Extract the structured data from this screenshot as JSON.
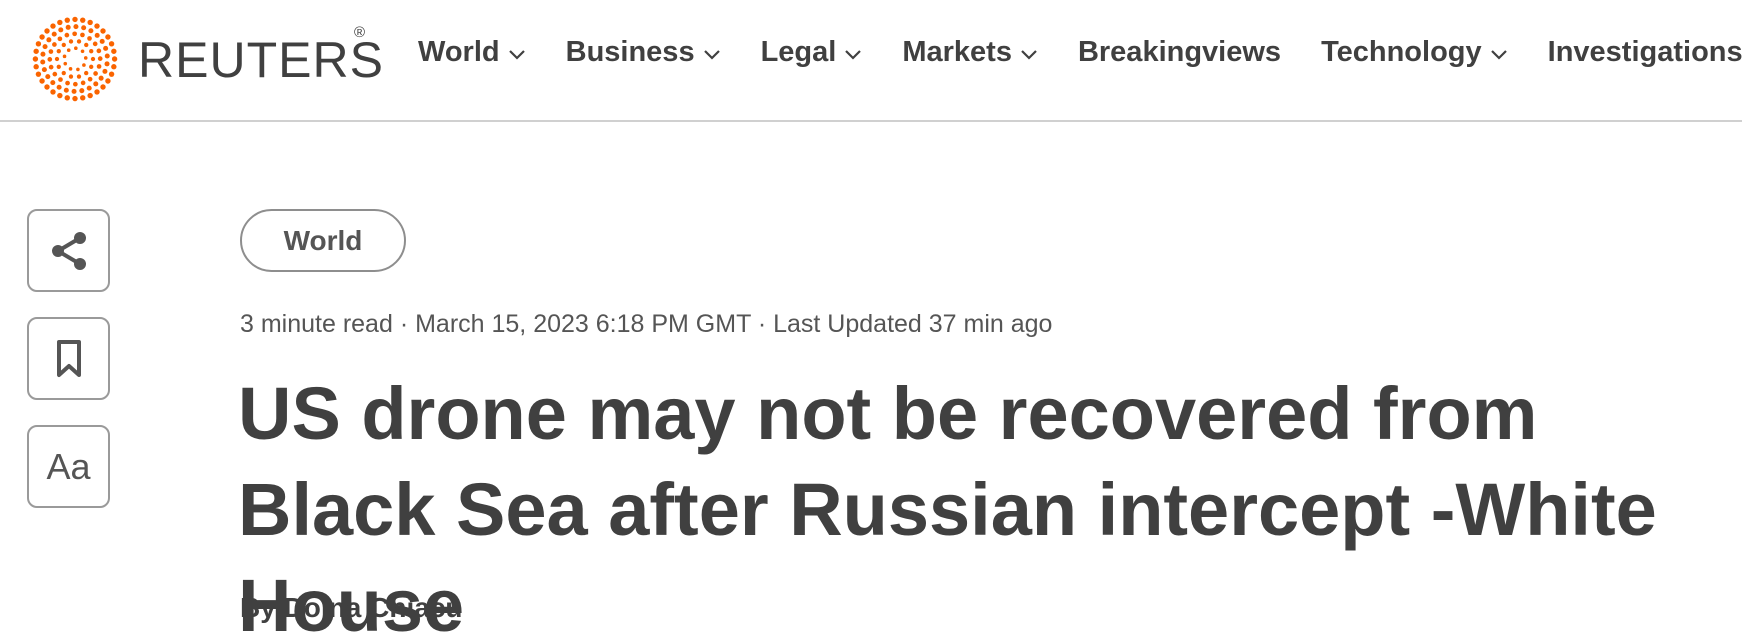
{
  "brand": {
    "name": "REUTERS",
    "reg_mark": "®",
    "accent_color": "#fa6400"
  },
  "nav": {
    "items": [
      {
        "label": "World",
        "has_dropdown": true
      },
      {
        "label": "Business",
        "has_dropdown": true
      },
      {
        "label": "Legal",
        "has_dropdown": true
      },
      {
        "label": "Markets",
        "has_dropdown": true
      },
      {
        "label": "Breakingviews",
        "has_dropdown": false
      },
      {
        "label": "Technology",
        "has_dropdown": true
      },
      {
        "label": "Investigations",
        "has_dropdown": false
      }
    ]
  },
  "tools": {
    "share_icon": "share-icon",
    "bookmark_icon": "bookmark-icon",
    "font_label": "Aa"
  },
  "article": {
    "section": "World",
    "meta": "3 minute read · March 15, 2023 6:18 PM GMT · Last Updated 37 min ago",
    "headline": "US drone may not be recovered from Black Sea after Russian intercept -White House",
    "byline_prefix": "By",
    "author": "Doina Chiacu"
  }
}
